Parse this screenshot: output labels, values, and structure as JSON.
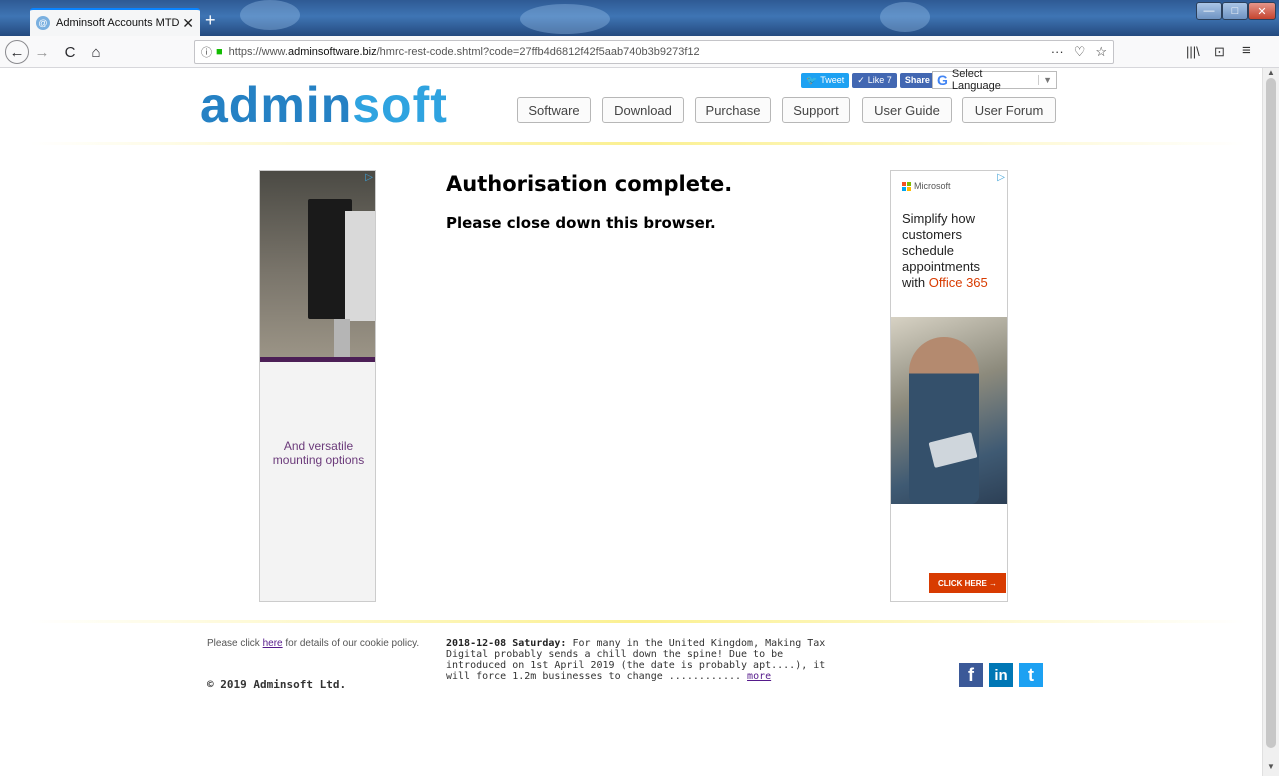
{
  "browser": {
    "tab_title": "Adminsoft Accounts MTD",
    "tab_close": "✕",
    "new_tab": "+",
    "url_prefix": "https://www.",
    "url_domain": "adminsoftware.biz",
    "url_rest": "/hmrc-rest-code.shtml?code=27ffb4d6812f42f5aab740b3b9273f12",
    "url_icons": [
      "···",
      "♡",
      "☆"
    ],
    "nav_icons": [
      "←",
      "→",
      "C",
      "⌂"
    ],
    "toolbar_icons": [
      "|||\\",
      "⊡",
      "≡"
    ]
  },
  "header": {
    "logo_part1": "admin",
    "logo_part2": "soft",
    "social": {
      "tweet": "Tweet",
      "like": "Like 7",
      "share": "Share"
    },
    "language": "Select Language",
    "menu": [
      "Software",
      "Download",
      "Purchase",
      "Support",
      "User Guide",
      "User Forum"
    ]
  },
  "main": {
    "heading": "Authorisation complete.",
    "subheading": "Please close down this browser."
  },
  "ads": {
    "left_text": "And versatile mounting options",
    "right_brand": "Microsoft",
    "right_copy": "Simplify how customers schedule appointments with",
    "right_highlight": "Office 365",
    "right_cta": "CLICK HERE →"
  },
  "footer": {
    "cookie_before": "Please click",
    "cookie_link": "here",
    "cookie_after": "for details of our cookie policy.",
    "copyright": "© 2019 Adminsoft Ltd.",
    "news_date": "2018-12-08 Saturday:",
    "news_text": "For many in the United Kingdom, Making Tax Digital probably sends a chill down the spine! Due to be introduced on 1st April 2019 (the date is probably apt....), it will force 1.2m businesses to change ............",
    "news_more": "more",
    "social_icons": [
      "f",
      "in",
      "t"
    ]
  },
  "colors": {
    "brand": "#2581c4",
    "accent": "#d83b01"
  }
}
